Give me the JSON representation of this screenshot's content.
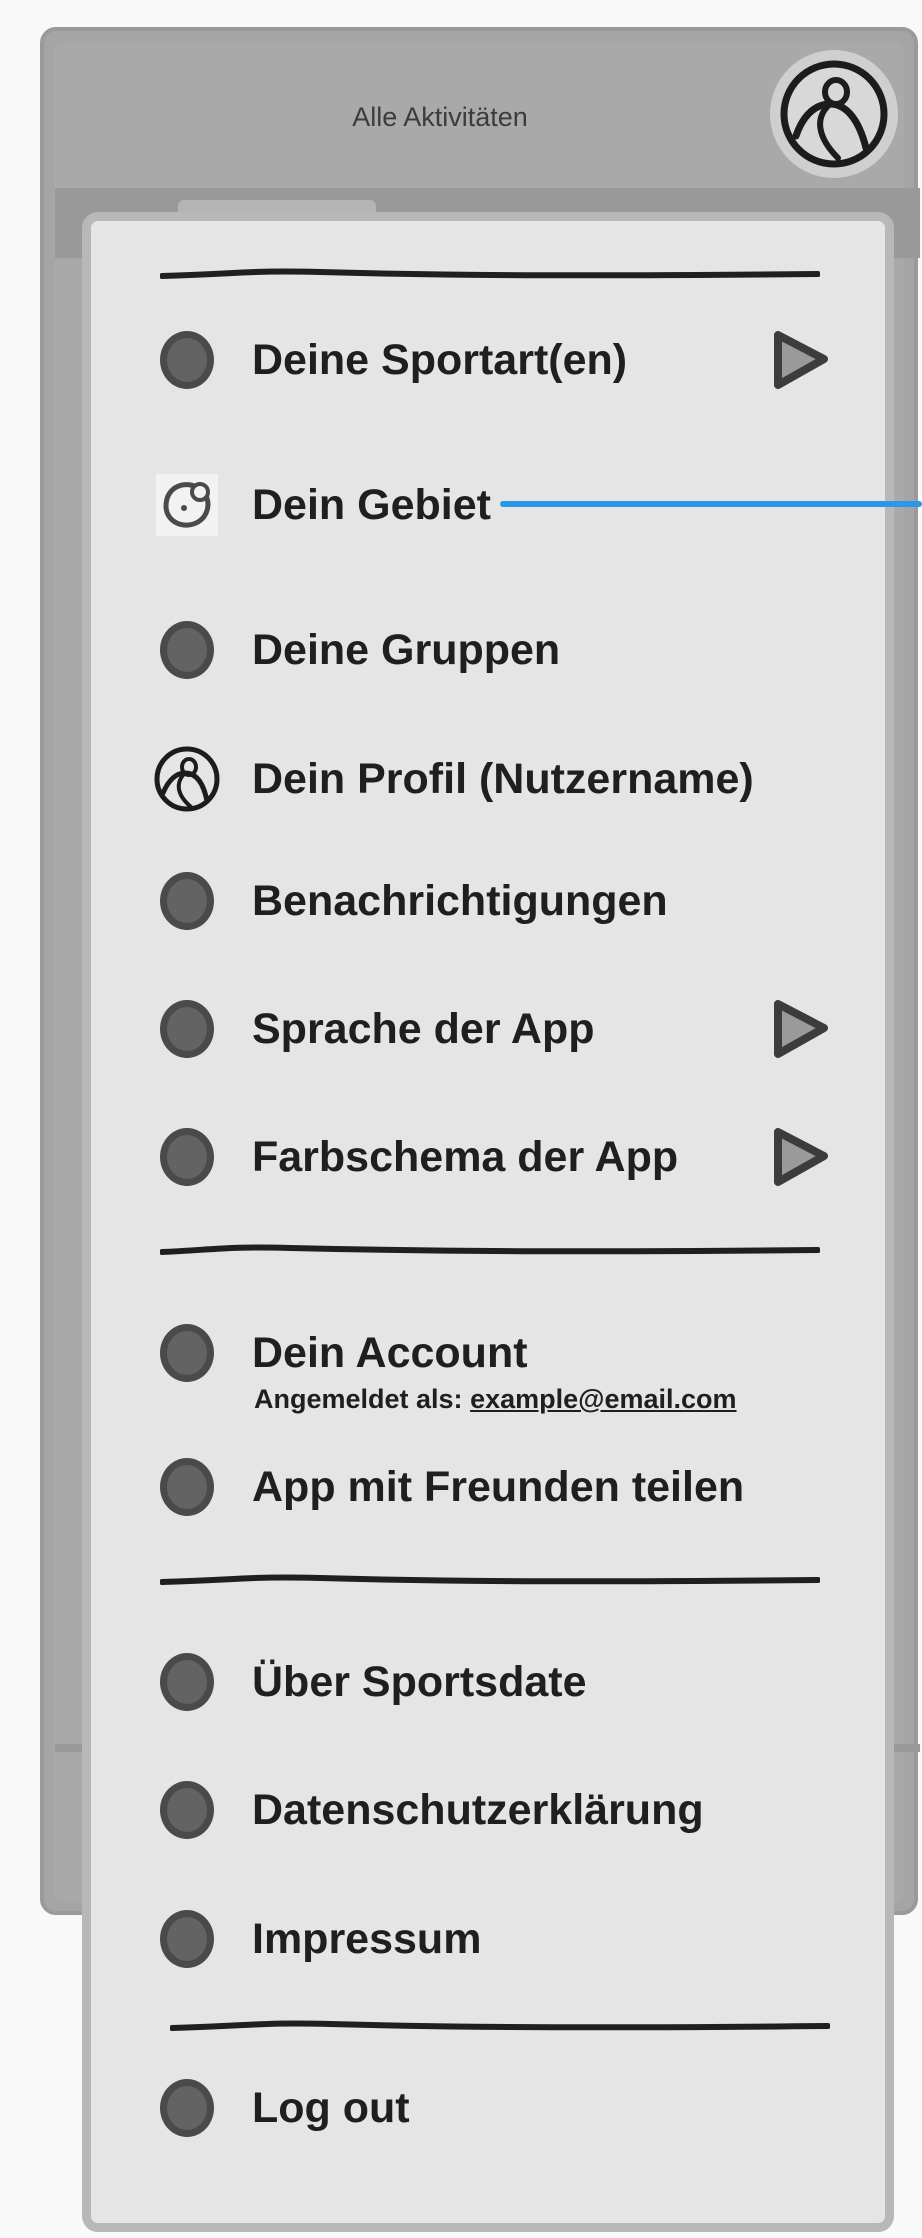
{
  "header": {
    "title": "Alle Aktivitäten"
  },
  "menu": {
    "section1": [
      {
        "label": "Deine Sportart(en)",
        "icon": "circle-bullet-icon",
        "has_chevron": true
      },
      {
        "label": "Dein Gebiet",
        "icon": "location-icon",
        "has_chevron": false
      },
      {
        "label": "Deine Gruppen",
        "icon": "circle-bullet-icon",
        "has_chevron": false
      },
      {
        "label": "Dein Profil (Nutzername)",
        "icon": "profile-icon",
        "has_chevron": false
      },
      {
        "label": "Benachrichtigungen",
        "icon": "circle-bullet-icon",
        "has_chevron": false
      },
      {
        "label": "Sprache der App",
        "icon": "circle-bullet-icon",
        "has_chevron": true
      },
      {
        "label": "Farbschema der App",
        "icon": "circle-bullet-icon",
        "has_chevron": true
      }
    ],
    "section2": {
      "account_label": "Dein Account",
      "account_sub_prefix": "Angemeldet als:",
      "account_email": "example@email.com",
      "share_label": "App mit Freunden teilen"
    },
    "section3": [
      {
        "label": "Über Sportsdate"
      },
      {
        "label": "Datenschutzerklärung"
      },
      {
        "label": "Impressum"
      }
    ],
    "section4": {
      "logout_label": "Log out"
    }
  },
  "colors": {
    "accent_line": "#2b97e7",
    "drawer_bg": "#e5e5e5",
    "bullet": "#4a4a4a"
  }
}
